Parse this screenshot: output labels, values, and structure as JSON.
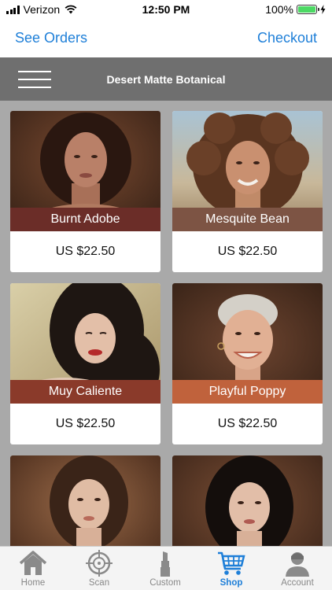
{
  "status_bar": {
    "carrier": "Verizon",
    "time": "12:50 PM",
    "battery": "100%"
  },
  "nav": {
    "left_label": "See Orders",
    "right_label": "Checkout"
  },
  "header": {
    "title": "Desert Matte Botanical"
  },
  "products": [
    {
      "name": "Burnt Adobe",
      "price": "US $22.50",
      "label_color": "#6b2d28"
    },
    {
      "name": "Mesquite Bean",
      "price": "US $22.50",
      "label_color": "#7d5444"
    },
    {
      "name": "Muy Caliente",
      "price": "US $22.50",
      "label_color": "#8a3a2a"
    },
    {
      "name": "Playful Poppy",
      "price": "US $22.50",
      "label_color": "#c0623c"
    }
  ],
  "tabs": [
    {
      "label": "Home",
      "icon": "home-icon"
    },
    {
      "label": "Scan",
      "icon": "crosshair-icon"
    },
    {
      "label": "Custom",
      "icon": "lipstick-icon"
    },
    {
      "label": "Shop",
      "icon": "cart-icon",
      "active": true
    },
    {
      "label": "Account",
      "icon": "person-icon"
    }
  ],
  "colors": {
    "accent": "#1e7fd8",
    "header_bg": "#6f6f6f",
    "grid_bg": "#a9a9a9"
  }
}
